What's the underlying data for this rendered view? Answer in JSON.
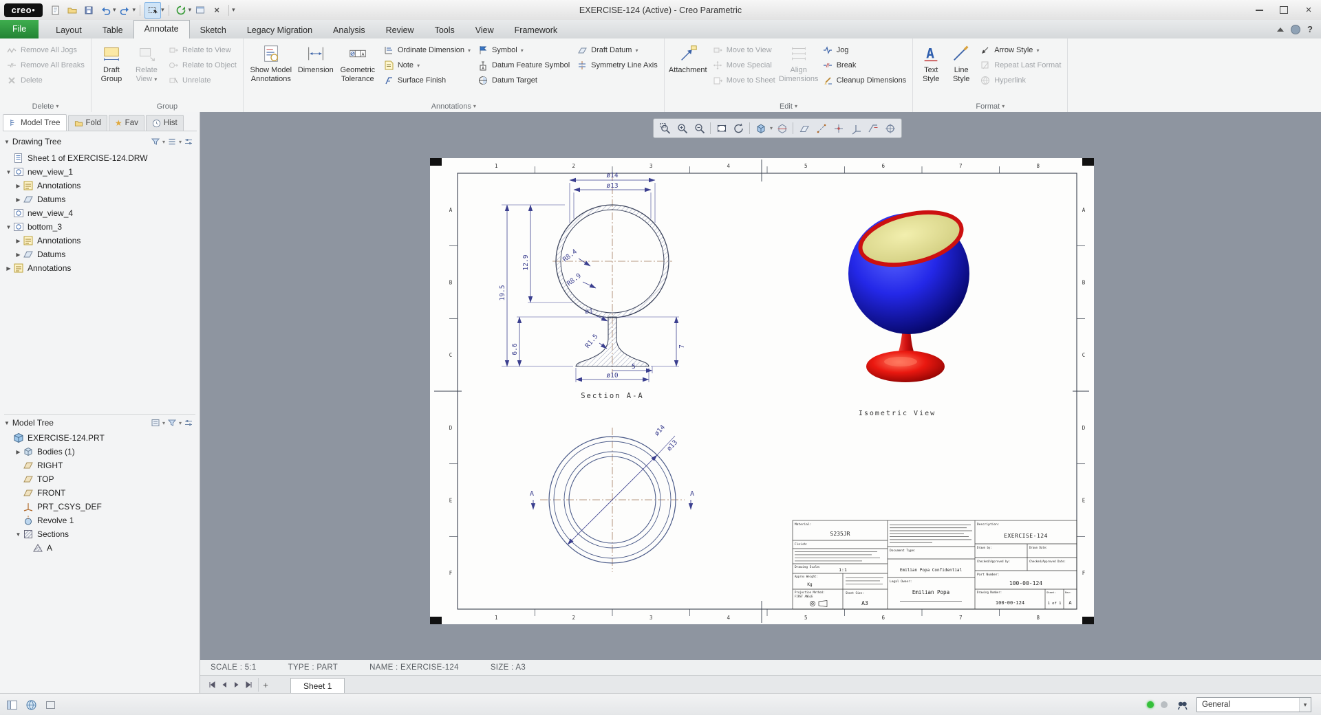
{
  "window": {
    "logo_text": "creo",
    "title": "EXERCISE-124 (Active) - Creo Parametric"
  },
  "menu_tabs": [
    {
      "label": "File"
    },
    {
      "label": "Layout"
    },
    {
      "label": "Table"
    },
    {
      "label": "Annotate"
    },
    {
      "label": "Sketch"
    },
    {
      "label": "Legacy Migration"
    },
    {
      "label": "Analysis"
    },
    {
      "label": "Review"
    },
    {
      "label": "Tools"
    },
    {
      "label": "View"
    },
    {
      "label": "Framework"
    }
  ],
  "ribbon": {
    "delete_group": {
      "label": "Delete",
      "remove_all_jogs": "Remove All Jogs",
      "remove_all_breaks": "Remove All Breaks",
      "delete_btn": "Delete"
    },
    "group_group": {
      "label": "Group",
      "draft_group": "Draft Group",
      "relate_view": "Relate View",
      "relate_to_view": "Relate to View",
      "relate_to_object": "Relate to Object",
      "unrelate": "Unrelate"
    },
    "annotations_group": {
      "label": "Annotations",
      "show_model_annotations": "Show Model Annotations",
      "dimension": "Dimension",
      "geometric_tolerance": "Geometric Tolerance",
      "ordinate_dimension": "Ordinate Dimension",
      "note": "Note",
      "surface_finish": "Surface Finish",
      "symbol": "Symbol",
      "datum_feature_symbol": "Datum Feature Symbol",
      "datum_target": "Datum Target",
      "draft_datum": "Draft Datum",
      "symmetry_line_axis": "Symmetry Line Axis"
    },
    "edit_group": {
      "label": "Edit",
      "attachment": "Attachment",
      "move_to_view": "Move to View",
      "move_special": "Move Special",
      "move_to_sheet": "Move to Sheet",
      "align_dimensions": "Align Dimensions",
      "jog": "Jog",
      "break_btn": "Break",
      "cleanup_dimensions": "Cleanup Dimensions"
    },
    "format_group": {
      "label": "Format",
      "text_style": "Text Style",
      "line_style": "Line Style",
      "arrow_style": "Arrow Style",
      "repeat_last_format": "Repeat Last Format",
      "hyperlink": "Hyperlink"
    }
  },
  "left_panel": {
    "tabs": [
      {
        "label": "Model Tree"
      },
      {
        "label": "Fold"
      },
      {
        "label": "Fav"
      },
      {
        "label": "Hist"
      }
    ],
    "drawing_tree": {
      "title": "Drawing Tree",
      "items": [
        {
          "label": "Sheet 1 of EXERCISE-124.DRW",
          "indent": 0,
          "icon": "sheet",
          "expand": ""
        },
        {
          "label": "new_view_1",
          "indent": 0,
          "icon": "view",
          "expand": "v"
        },
        {
          "label": "Annotations",
          "indent": 1,
          "icon": "annotations",
          "expand": ">"
        },
        {
          "label": "Datums",
          "indent": 1,
          "icon": "datums",
          "expand": ">"
        },
        {
          "label": "new_view_4",
          "indent": 0,
          "icon": "view",
          "expand": ""
        },
        {
          "label": "bottom_3",
          "indent": 0,
          "icon": "view",
          "expand": "v"
        },
        {
          "label": "Annotations",
          "indent": 1,
          "icon": "annotations",
          "expand": ">"
        },
        {
          "label": "Datums",
          "indent": 1,
          "icon": "datums",
          "expand": ">"
        },
        {
          "label": "Annotations",
          "indent": 0,
          "icon": "annotations",
          "expand": ">"
        }
      ]
    },
    "model_tree": {
      "title": "Model Tree",
      "items": [
        {
          "label": "EXERCISE-124.PRT",
          "indent": 0,
          "icon": "part",
          "expand": ""
        },
        {
          "label": "Bodies (1)",
          "indent": 1,
          "icon": "bodies",
          "expand": ">"
        },
        {
          "label": "RIGHT",
          "indent": 1,
          "icon": "plane",
          "expand": ""
        },
        {
          "label": "TOP",
          "indent": 1,
          "icon": "plane",
          "expand": ""
        },
        {
          "label": "FRONT",
          "indent": 1,
          "icon": "plane",
          "expand": ""
        },
        {
          "label": "PRT_CSYS_DEF",
          "indent": 1,
          "icon": "csys",
          "expand": ""
        },
        {
          "label": "Revolve 1",
          "indent": 1,
          "icon": "revolve",
          "expand": ""
        },
        {
          "label": "Sections",
          "indent": 1,
          "icon": "sections",
          "expand": "v"
        },
        {
          "label": "A",
          "indent": 2,
          "icon": "section",
          "expand": ""
        }
      ]
    }
  },
  "canvas_toolbar": {
    "icons": [
      "zoom-region",
      "zoom-in",
      "zoom-out",
      "refit",
      "repaint",
      "display-style",
      "section-view",
      "datum-plane-display",
      "datum-axis-display",
      "point-symbol-display",
      "csys-display",
      "annotation-display",
      "spin-center"
    ]
  },
  "statusbar": {
    "scale": "SCALE : 5:1",
    "type": "TYPE : PART",
    "name": "NAME : EXERCISE-124",
    "size": "SIZE : A3"
  },
  "sheet_bar": {
    "tab": "Sheet 1"
  },
  "bottom_bar": {
    "display_filter": "General"
  },
  "drawing": {
    "zones": {
      "cols": [
        "1",
        "2",
        "3",
        "4",
        "5",
        "6",
        "7",
        "8"
      ],
      "rows": [
        "A",
        "B",
        "C",
        "D",
        "E",
        "F"
      ]
    },
    "dims": {
      "dia14": "ø14",
      "dia13": "ø13",
      "h19_5": "19.5",
      "h12_9": "12.9",
      "h6_6": "6.6",
      "r8_4": "R8.4",
      "r8_9": "R8.9",
      "dia1": "ø1",
      "r1_5": "R1.5",
      "h7": "7",
      "w5": "5",
      "dia10": "ø10",
      "bottom_dia14": "ø14",
      "bottom_dia13": "ø13",
      "section_letter": "A"
    },
    "labels": {
      "section": "Section A-A",
      "iso": "Isometric View"
    },
    "title_block": {
      "material_label": "Material:",
      "material_value": "S235JR",
      "finish_label": "Finish:",
      "scale_label": "Drawing Scale:",
      "scale_value": "1:1",
      "weight_label": "Approx Weight:",
      "weight_value": "Kg",
      "projection_label": "Projection Method:",
      "projection_value": "FIRST ANGLE",
      "sheet_size_label": "Sheet Size:",
      "sheet_size_value": "A3",
      "document_type_label": "Document Type:",
      "confidential_line": "Emilian Popa Confidential",
      "legal_owner_label": "Legal Owner:",
      "legal_owner_value": "Emilian Popa",
      "description_label": "Description:",
      "description_value": "EXERCISE-124",
      "drawn_by_label": "Drawn by:",
      "drawn_date_label": "Drawn Date:",
      "checked_by_label": "Checked/Approved by:",
      "checked_date_label": "Checked/Approved Date:",
      "part_number_label": "Part Number:",
      "part_number_value": "100-00-124",
      "drawing_number_label": "Drawing Number:",
      "drawing_number_value": "100-00-124",
      "sheet_label": "Sheet:",
      "sheet_value": "1 of 1",
      "rev_label": "Rev:",
      "rev_value": "A"
    }
  }
}
